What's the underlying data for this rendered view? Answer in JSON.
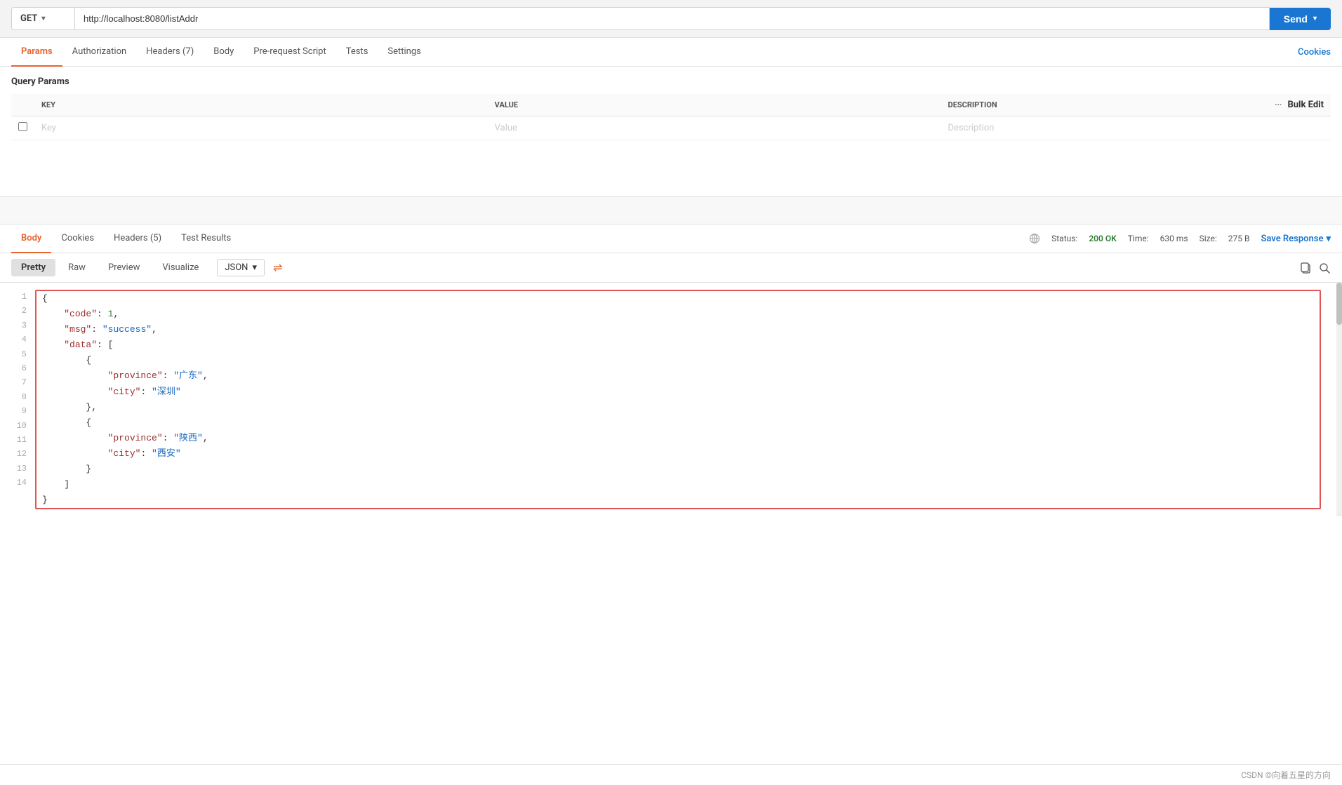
{
  "url_bar": {
    "method": "GET",
    "url": "http://localhost:8080/listAddr",
    "send_label": "Send",
    "method_chevron": "▾",
    "send_chevron": "▾"
  },
  "request_tabs": {
    "tabs": [
      {
        "id": "params",
        "label": "Params",
        "active": true
      },
      {
        "id": "authorization",
        "label": "Authorization",
        "active": false
      },
      {
        "id": "headers",
        "label": "Headers (7)",
        "active": false
      },
      {
        "id": "body",
        "label": "Body",
        "active": false
      },
      {
        "id": "pre-request-script",
        "label": "Pre-request Script",
        "active": false
      },
      {
        "id": "tests",
        "label": "Tests",
        "active": false
      },
      {
        "id": "settings",
        "label": "Settings",
        "active": false
      }
    ],
    "cookies_label": "Cookies"
  },
  "query_params": {
    "title": "Query Params",
    "columns": {
      "key": "KEY",
      "value": "VALUE",
      "description": "DESCRIPTION",
      "bulk_edit": "Bulk Edit"
    },
    "placeholder_row": {
      "key": "Key",
      "value": "Value",
      "description": "Description"
    }
  },
  "response": {
    "tabs": [
      {
        "id": "body",
        "label": "Body",
        "active": true
      },
      {
        "id": "cookies",
        "label": "Cookies",
        "active": false
      },
      {
        "id": "headers",
        "label": "Headers (5)",
        "active": false
      },
      {
        "id": "test-results",
        "label": "Test Results",
        "active": false
      }
    ],
    "status": {
      "label": "Status:",
      "code": "200 OK",
      "time_label": "Time:",
      "time_value": "630 ms",
      "size_label": "Size:",
      "size_value": "275 B"
    },
    "save_response_label": "Save Response",
    "format_tabs": [
      {
        "id": "pretty",
        "label": "Pretty",
        "active": true
      },
      {
        "id": "raw",
        "label": "Raw",
        "active": false
      },
      {
        "id": "preview",
        "label": "Preview",
        "active": false
      },
      {
        "id": "visualize",
        "label": "Visualize",
        "active": false
      }
    ],
    "format_selector": "JSON",
    "json_content": [
      {
        "line": 1,
        "text": "{"
      },
      {
        "line": 2,
        "text": "    \"code\": 1,"
      },
      {
        "line": 3,
        "text": "    \"msg\": \"success\","
      },
      {
        "line": 4,
        "text": "    \"data\": ["
      },
      {
        "line": 5,
        "text": "        {"
      },
      {
        "line": 6,
        "text": "            \"province\": \"广东\","
      },
      {
        "line": 7,
        "text": "            \"city\": \"深圳\""
      },
      {
        "line": 8,
        "text": "        },"
      },
      {
        "line": 9,
        "text": "        {"
      },
      {
        "line": 10,
        "text": "            \"province\": \"陕西\","
      },
      {
        "line": 11,
        "text": "            \"city\": \"西安\""
      },
      {
        "line": 12,
        "text": "        }"
      },
      {
        "line": 13,
        "text": "    ]"
      },
      {
        "line": 14,
        "text": "}"
      }
    ]
  },
  "footer": {
    "text": "CSDN ©向着五星的方向"
  },
  "colors": {
    "active_tab": "#e8622c",
    "send_btn": "#1976d2",
    "status_ok": "#2e7d32",
    "cookies_link": "#1976d2",
    "json_border": "#e05555"
  }
}
